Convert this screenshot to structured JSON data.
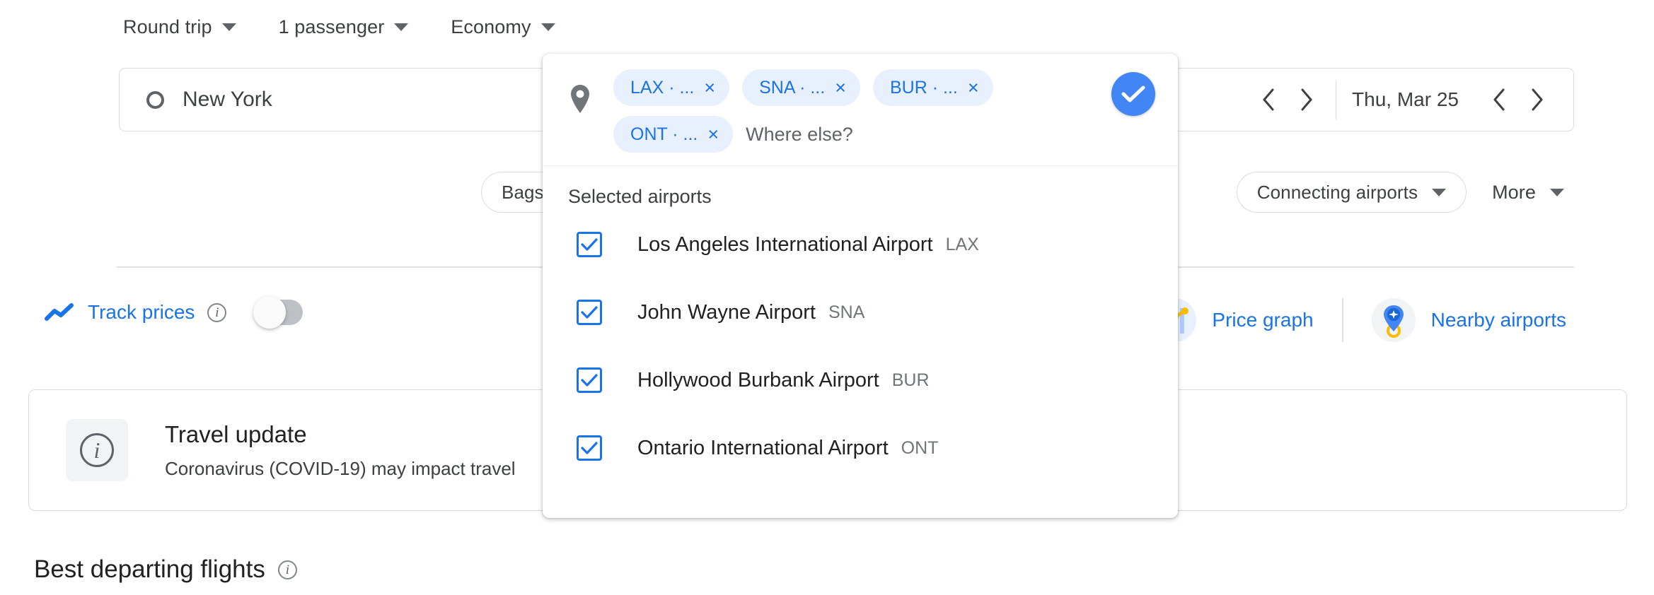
{
  "trip_options": [
    {
      "label": "Round trip",
      "icon": "chevron-down-icon"
    },
    {
      "label": "1 passenger",
      "icon": "chevron-down-icon"
    },
    {
      "label": "Economy",
      "icon": "chevron-down-icon"
    }
  ],
  "search": {
    "origin_value": "New York",
    "origin_icon": "circle-outline-icon",
    "swap_icon": "swap-arrows-icon",
    "date_label": "Thu, Mar 25",
    "prev_icon": "chevron-left-icon",
    "next_icon": "chevron-right-icon"
  },
  "filters": {
    "bags": "Bags",
    "connecting_airports": "Connecting airports",
    "more": "More"
  },
  "track_prices": {
    "label": "Track prices",
    "trend_icon": "trend-line-icon",
    "info_icon": "info-icon",
    "info_glyph": "i",
    "toggle_on": false
  },
  "quick_links": [
    {
      "label": "Price graph",
      "icon": "price-graph-icon"
    },
    {
      "label": "Nearby airports",
      "icon": "nearby-airports-pin-icon"
    }
  ],
  "travel_update": {
    "icon": "info-icon",
    "info_glyph": "i",
    "title": "Travel update",
    "description": "Coronavirus (COVID-19) may impact travel"
  },
  "best_departing": {
    "title": "Best departing flights",
    "info_icon": "info-icon",
    "info_glyph": "i"
  },
  "airport_popup": {
    "pin_icon": "location-pin-icon",
    "done_icon": "check-icon",
    "where_else_placeholder": "Where else?",
    "chips": [
      {
        "label": "LAX · ...",
        "remove_icon": "close-icon",
        "remove_glyph": "×"
      },
      {
        "label": "SNA · ...",
        "remove_icon": "close-icon",
        "remove_glyph": "×"
      },
      {
        "label": "BUR · ...",
        "remove_icon": "close-icon",
        "remove_glyph": "×"
      },
      {
        "label": "ONT · ...",
        "remove_icon": "close-icon",
        "remove_glyph": "×"
      }
    ],
    "section_title": "Selected airports",
    "airports": [
      {
        "name": "Los Angeles International Airport",
        "code": "LAX",
        "checked": true
      },
      {
        "name": "John Wayne Airport",
        "code": "SNA",
        "checked": true
      },
      {
        "name": "Hollywood Burbank Airport",
        "code": "BUR",
        "checked": true
      },
      {
        "name": "Ontario International Airport",
        "code": "ONT",
        "checked": true
      }
    ]
  },
  "colors": {
    "accent_blue": "#1a73e8",
    "done_blue": "#4285f4",
    "chip_bg": "#e8f0fe",
    "text_primary": "#202124",
    "text_secondary": "#5f6368",
    "border": "#dadce0"
  }
}
